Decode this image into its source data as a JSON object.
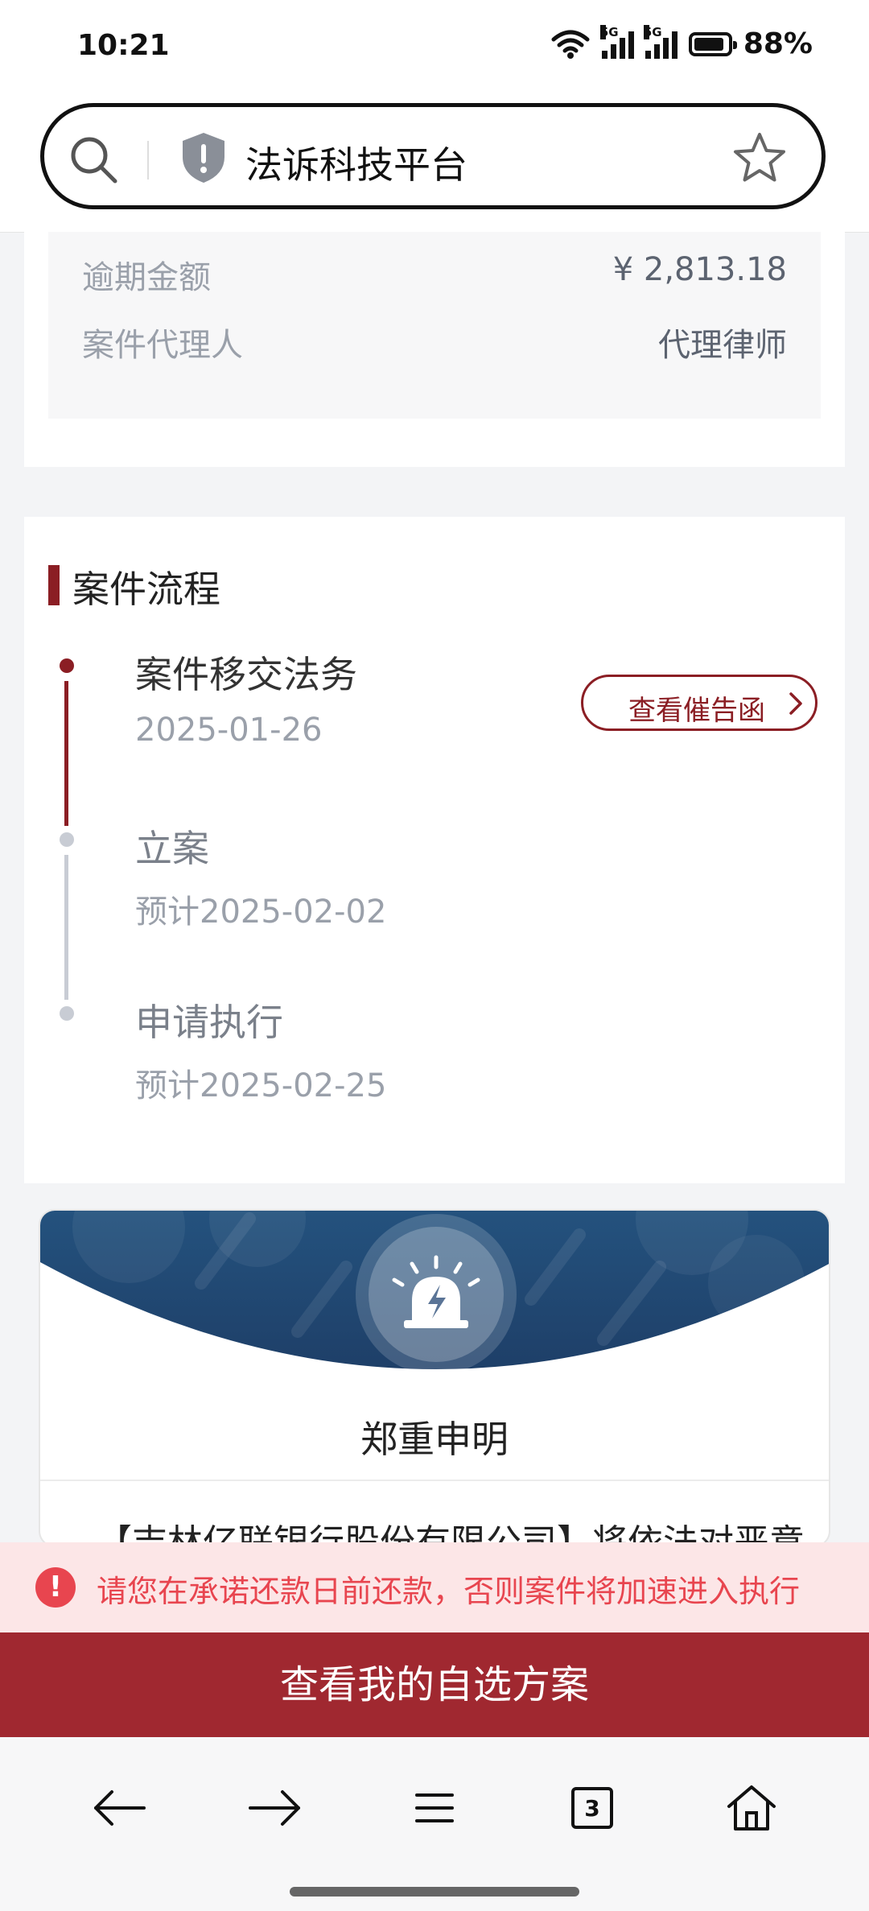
{
  "status_bar": {
    "time": "10:21",
    "battery": "88%",
    "net1": "5G",
    "net2": "5G"
  },
  "address_bar": {
    "title": "法诉科技平台"
  },
  "case_info": {
    "rows": [
      {
        "label": "逾期金额",
        "value": "¥ 2,813.18"
      },
      {
        "label": "案件代理人",
        "value": "代理律师"
      }
    ]
  },
  "process": {
    "title": "案件流程",
    "steps": [
      {
        "title": "案件移交法务",
        "date": "2025-01-26",
        "status": "done"
      },
      {
        "title": "立案",
        "date": "预计2025-02-02",
        "status": "pending"
      },
      {
        "title": "申请执行",
        "date": "预计2025-02-25",
        "status": "pending"
      }
    ],
    "letter_button": "查看催告函"
  },
  "declaration": {
    "title": "郑重申明",
    "text": "【吉林亿联银行股份有限公司】将依法对恶意"
  },
  "warning": {
    "text": "请您在承诺还款日前还款，否则案件将加速进入执行"
  },
  "cta": {
    "label": "查看我的自选方案"
  },
  "nav": {
    "tab_count": "3"
  },
  "colors": {
    "brand": "#8b1e24",
    "cta": "#a02830",
    "warning": "#e8454f",
    "warning_bg": "#fce6e7"
  }
}
